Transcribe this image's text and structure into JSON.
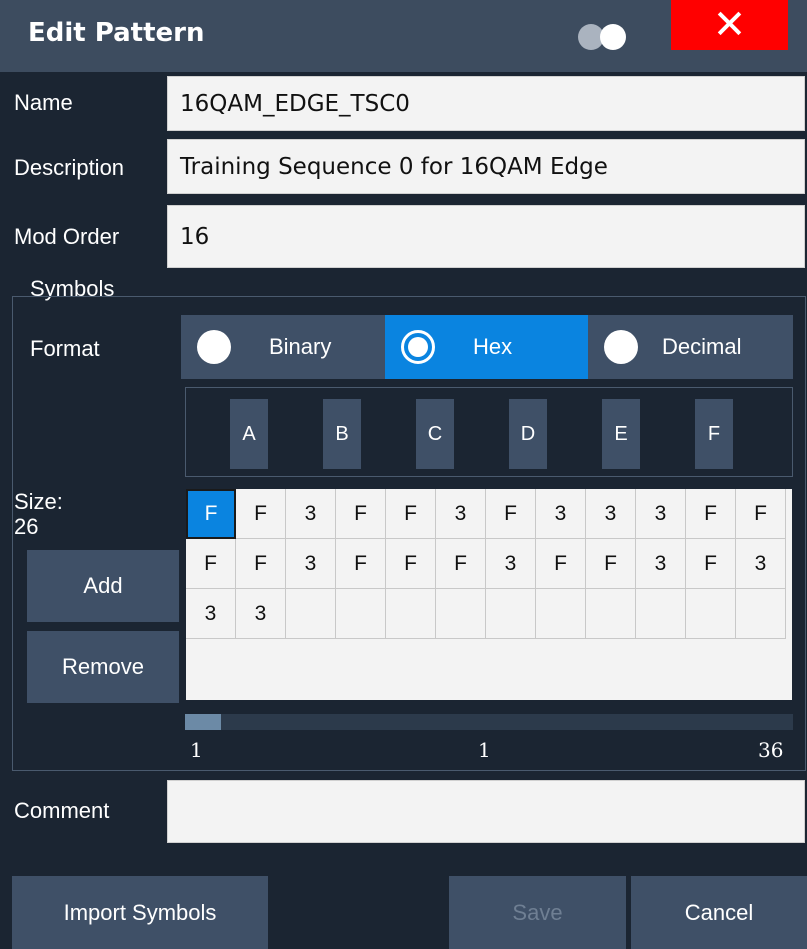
{
  "dialog": {
    "title": "Edit Pattern",
    "close_icon": "close-icon",
    "toggle_icon": "toggle-icon"
  },
  "fields": {
    "name_label": "Name",
    "name_value": "16QAM_EDGE_TSC0",
    "description_label": "Description",
    "description_value": "Training Sequence 0 for 16QAM Edge",
    "mod_order_label": "Mod Order",
    "mod_order_value": "16",
    "comment_label": "Comment",
    "comment_value": ""
  },
  "symbols": {
    "group_label": "Symbols",
    "format_label": "Format",
    "formats": [
      {
        "label": "Binary",
        "selected": false
      },
      {
        "label": "Hex",
        "selected": true
      },
      {
        "label": "Decimal",
        "selected": false
      }
    ],
    "keypad": [
      "A",
      "B",
      "C",
      "D",
      "E",
      "F"
    ],
    "size_label": "Size:",
    "size_value": "26",
    "add_label": "Add",
    "remove_label": "Remove",
    "grid_columns": 12,
    "grid_rows": 3,
    "cells": [
      "F",
      "F",
      "3",
      "F",
      "F",
      "3",
      "F",
      "3",
      "3",
      "3",
      "F",
      "F",
      "F",
      "F",
      "3",
      "F",
      "F",
      "F",
      "3",
      "F",
      "F",
      "3",
      "F",
      "3",
      "3",
      "3"
    ],
    "selected_cell": 0,
    "scroll_min": "1",
    "scroll_current": "1",
    "scroll_max": "36",
    "scroll_fraction": 0.06
  },
  "buttons": {
    "import_label": "Import Symbols",
    "save_label": "Save",
    "cancel_label": "Cancel"
  },
  "colors": {
    "accent": "#0a84e0",
    "close": "#ff0000",
    "background": "#1b2532",
    "panel": "#3f5067"
  }
}
